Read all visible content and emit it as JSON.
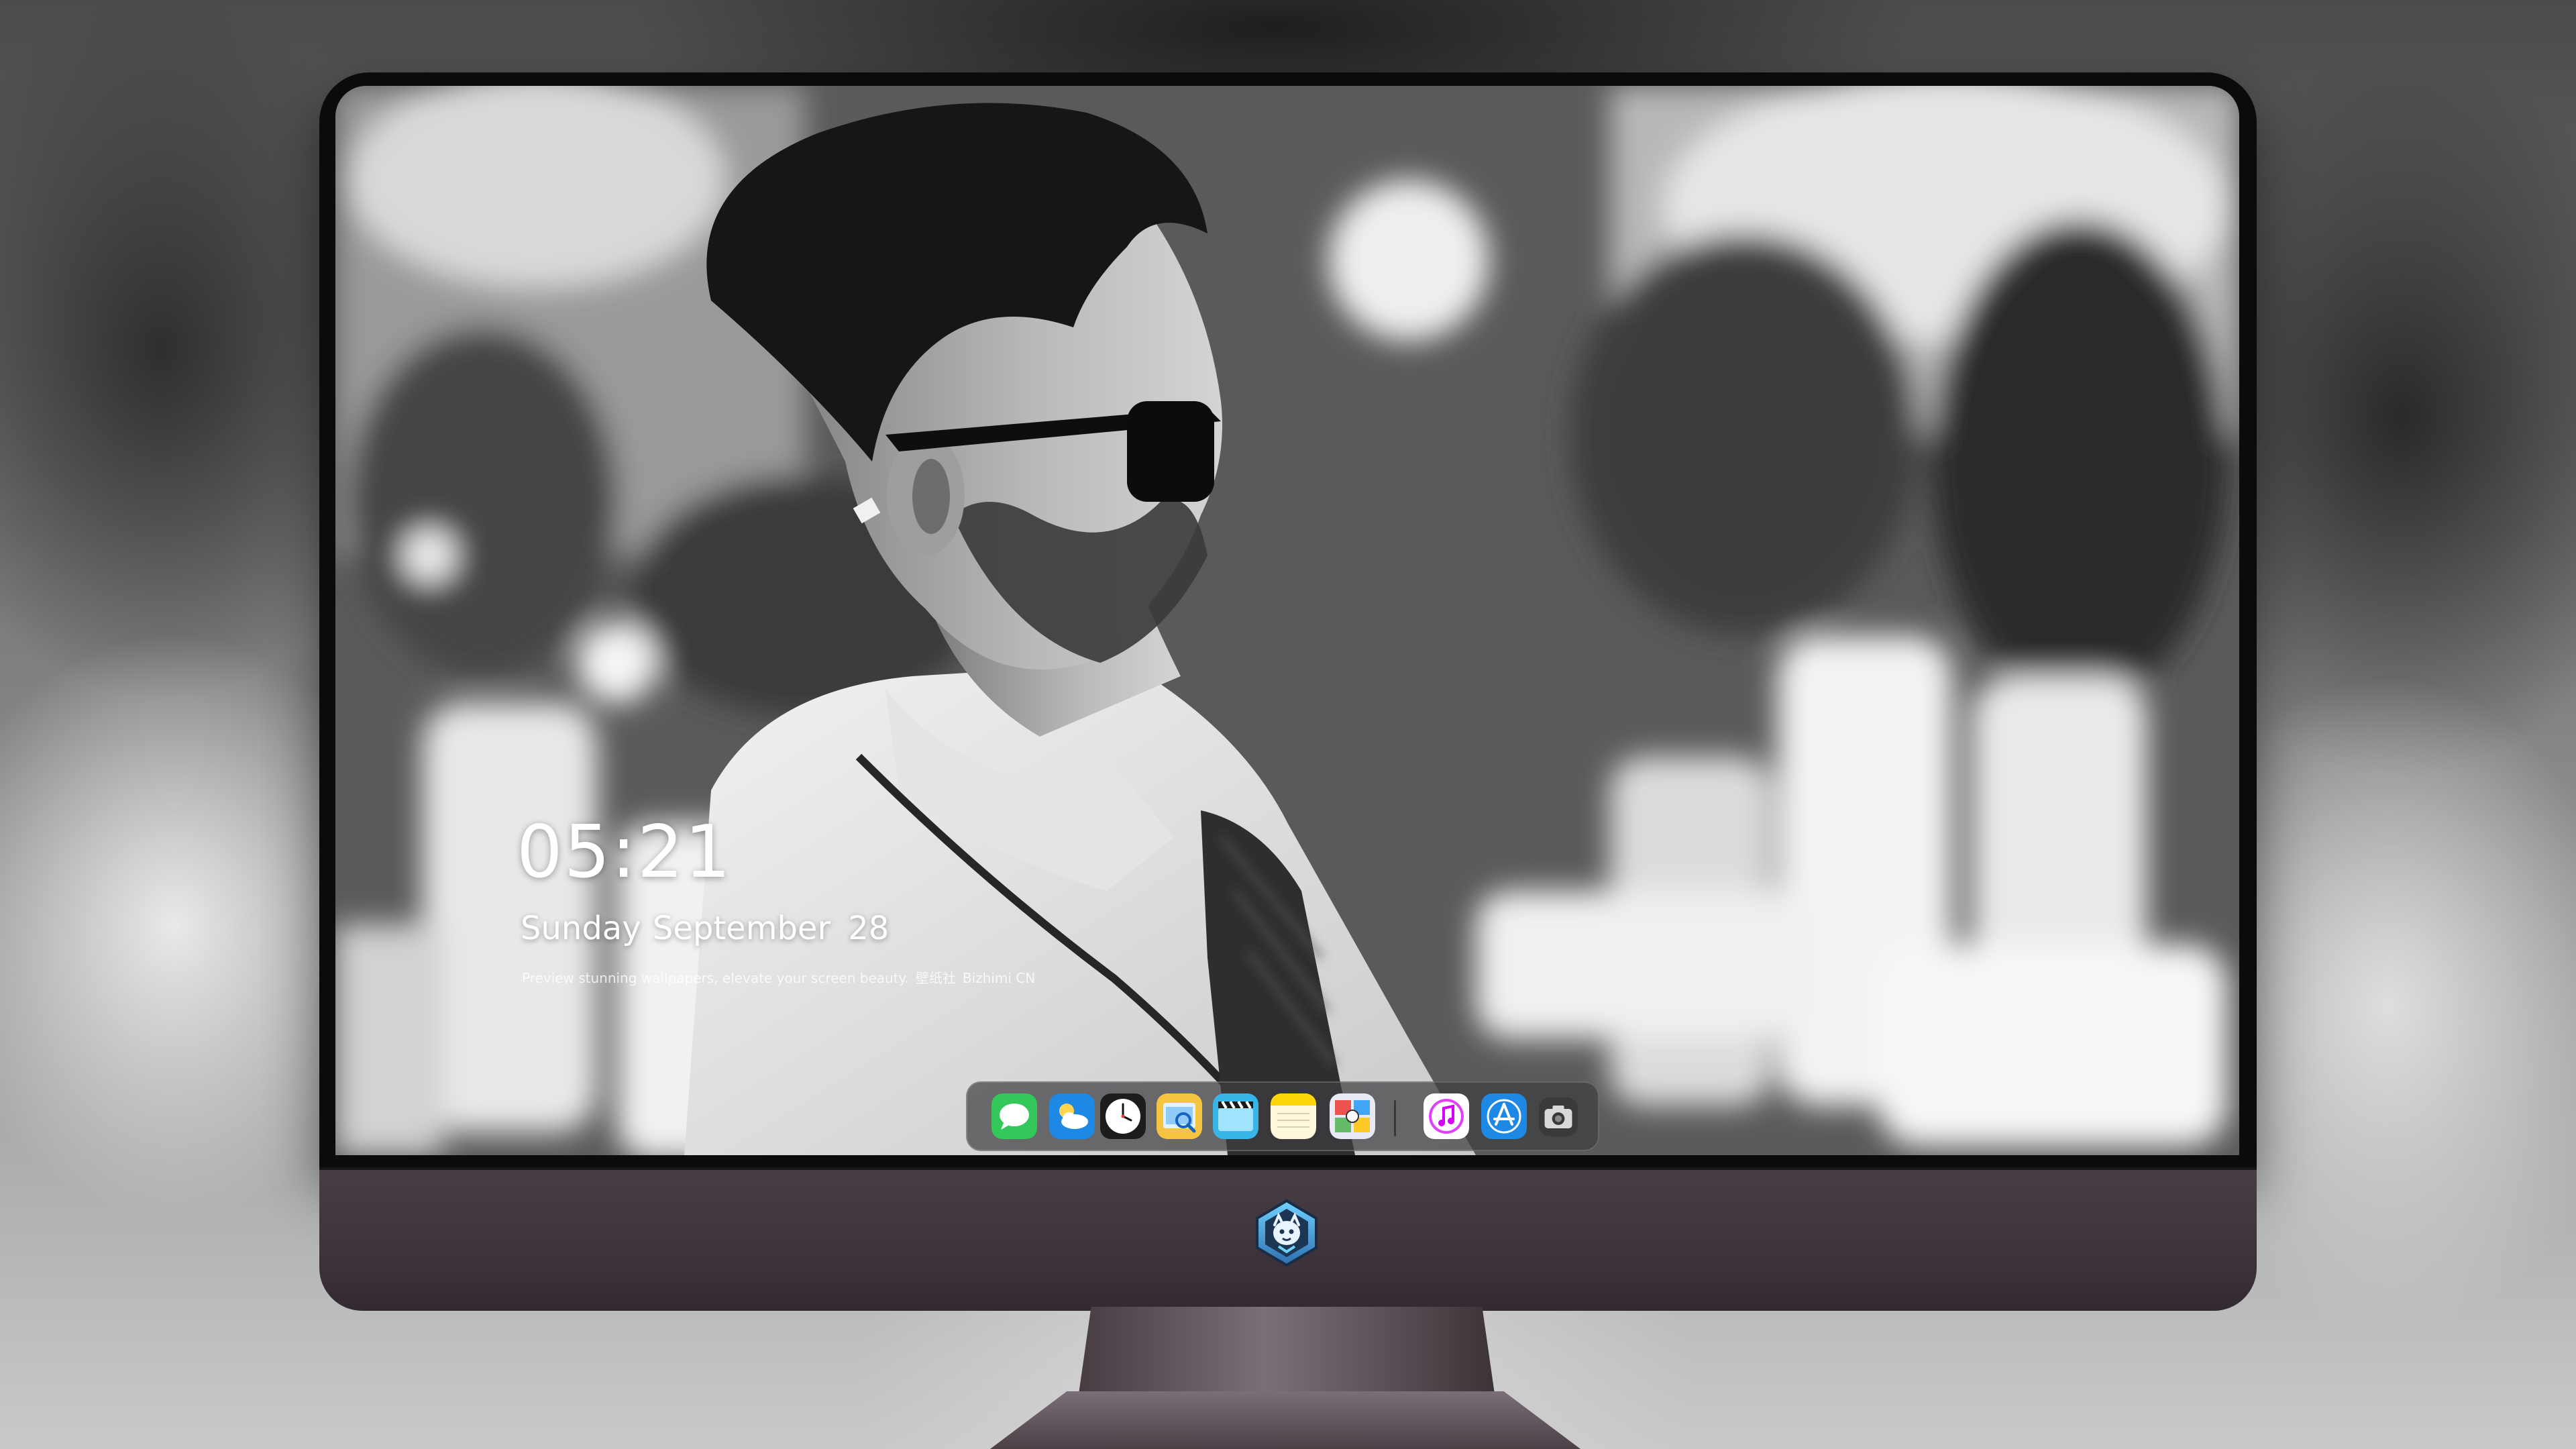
{
  "lockscreen": {
    "time": "05:21",
    "weekday": "Sunday",
    "month": "September",
    "day": "28",
    "tagline_en": "Preview stunning wallpapers, elevate your screen beauty.",
    "tagline_cn": "壁纸社",
    "tagline_site": "Bizhimi CN"
  },
  "dock": {
    "apps": [
      {
        "name": "messages-icon",
        "color": "#34c759"
      },
      {
        "name": "weather-icon",
        "color": "#1e88e5"
      },
      {
        "name": "clock-icon",
        "color": "#1c1c1e"
      },
      {
        "name": "preview-icon",
        "color": "#f5c542"
      },
      {
        "name": "video-editor-icon",
        "color": "#38b6e8"
      },
      {
        "name": "notes-icon",
        "color": "#ffd60a"
      },
      {
        "name": "photo-booth-icon",
        "color": "#4caf50"
      },
      {
        "name": "itunes-icon",
        "color": "#e040fb"
      },
      {
        "name": "app-store-icon",
        "color": "#1e88e5"
      },
      {
        "name": "screenshot-icon",
        "color": "#3a3a3c"
      }
    ]
  },
  "device": {
    "bezel_color": "#0b0b0c",
    "chin_color": "#473e45",
    "logo": "dragon-logo-icon"
  }
}
